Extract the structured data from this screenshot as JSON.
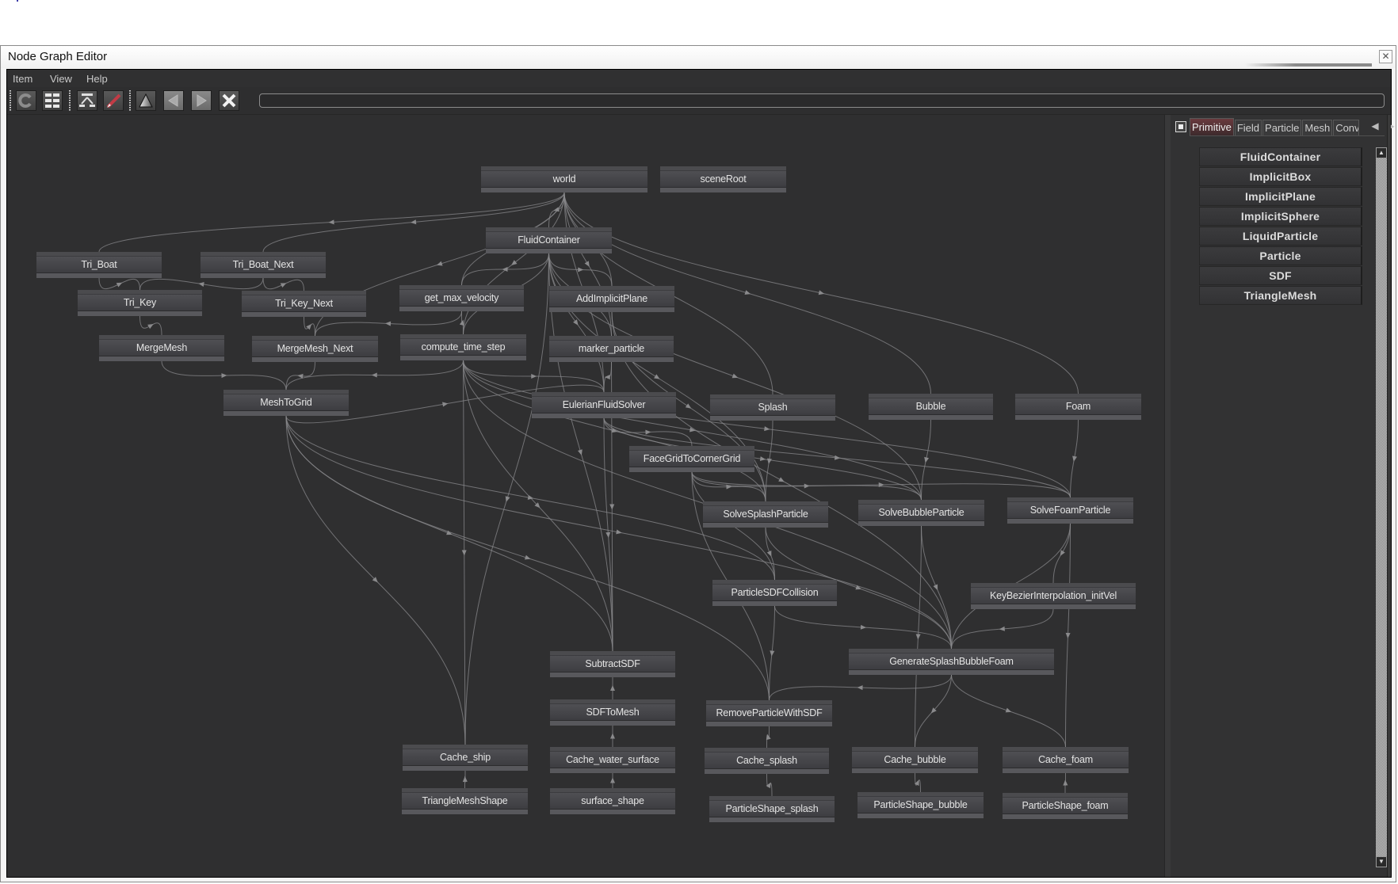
{
  "window": {
    "title": "Node Graph Editor",
    "close_icon": "close-icon"
  },
  "menu": [
    {
      "label": "Item"
    },
    {
      "label": "View"
    },
    {
      "label": "Help"
    }
  ],
  "toolbar": {
    "buttons": [
      {
        "name": "refresh",
        "icon": "refresh-icon"
      },
      {
        "name": "grid-layout",
        "icon": "grid-icon"
      },
      {
        "name": "hierarchy-layout",
        "icon": "hierarchy-icon"
      },
      {
        "name": "edit",
        "icon": "pencil-icon"
      },
      {
        "name": "up",
        "icon": "triangle-up-icon"
      },
      {
        "name": "back",
        "icon": "arrow-left-icon"
      },
      {
        "name": "forward",
        "icon": "arrow-right-icon"
      },
      {
        "name": "delete",
        "icon": "x-icon"
      }
    ],
    "search_value": ""
  },
  "graph": {
    "nodes": [
      {
        "id": "world",
        "label": "world"
      },
      {
        "id": "sceneRoot",
        "label": "sceneRoot"
      },
      {
        "id": "FluidContainer",
        "label": "FluidContainer"
      },
      {
        "id": "Tri_Boat",
        "label": "Tri_Boat"
      },
      {
        "id": "Tri_Boat_Next",
        "label": "Tri_Boat_Next"
      },
      {
        "id": "Tri_Key",
        "label": "Tri_Key"
      },
      {
        "id": "Tri_Key_Next",
        "label": "Tri_Key_Next"
      },
      {
        "id": "get_max_velocity",
        "label": "get_max_velocity"
      },
      {
        "id": "AddImplicitPlane",
        "label": "AddImplicitPlane"
      },
      {
        "id": "MergeMesh",
        "label": "MergeMesh"
      },
      {
        "id": "MergeMesh_Next",
        "label": "MergeMesh_Next"
      },
      {
        "id": "compute_time_step",
        "label": "compute_time_step"
      },
      {
        "id": "marker_particle",
        "label": "marker_particle"
      },
      {
        "id": "MeshToGrid",
        "label": "MeshToGrid"
      },
      {
        "id": "EulerianFluidSolver",
        "label": "EulerianFluidSolver"
      },
      {
        "id": "Splash",
        "label": "Splash"
      },
      {
        "id": "Bubble",
        "label": "Bubble"
      },
      {
        "id": "Foam",
        "label": "Foam"
      },
      {
        "id": "FaceGridToCornerGrid",
        "label": "FaceGridToCornerGrid"
      },
      {
        "id": "SolveSplashParticle",
        "label": "SolveSplashParticle"
      },
      {
        "id": "SolveBubbleParticle",
        "label": "SolveBubbleParticle"
      },
      {
        "id": "SolveFoamParticle",
        "label": "SolveFoamParticle"
      },
      {
        "id": "ParticleSDFCollision",
        "label": "ParticleSDFCollision"
      },
      {
        "id": "KeyBezierInterpolation_initVel",
        "label": "KeyBezierInterpolation_initVel"
      },
      {
        "id": "GenerateSplashBubbleFoam",
        "label": "GenerateSplashBubbleFoam"
      },
      {
        "id": "SubtractSDF",
        "label": "SubtractSDF"
      },
      {
        "id": "SDFToMesh",
        "label": "SDFToMesh"
      },
      {
        "id": "RemoveParticleWithSDF",
        "label": "RemoveParticleWithSDF"
      },
      {
        "id": "Cache_ship",
        "label": "Cache_ship"
      },
      {
        "id": "Cache_water_surface",
        "label": "Cache_water_surface"
      },
      {
        "id": "Cache_splash",
        "label": "Cache_splash"
      },
      {
        "id": "Cache_bubble",
        "label": "Cache_bubble"
      },
      {
        "id": "Cache_foam",
        "label": "Cache_foam"
      },
      {
        "id": "TriangleMeshShape",
        "label": "TriangleMeshShape"
      },
      {
        "id": "surface_shape",
        "label": "surface_shape"
      },
      {
        "id": "ParticleShape_splash",
        "label": "ParticleShape_splash"
      },
      {
        "id": "ParticleShape_bubble",
        "label": "ParticleShape_bubble"
      },
      {
        "id": "ParticleShape_foam",
        "label": "ParticleShape_foam"
      }
    ],
    "edges": [
      [
        "world",
        "FluidContainer"
      ],
      [
        "world",
        "Tri_Boat"
      ],
      [
        "world",
        "Tri_Boat_Next"
      ],
      [
        "world",
        "get_max_velocity"
      ],
      [
        "world",
        "AddImplicitPlane"
      ],
      [
        "world",
        "MergeMesh_Next"
      ],
      [
        "world",
        "compute_time_step"
      ],
      [
        "world",
        "marker_particle"
      ],
      [
        "world",
        "Splash"
      ],
      [
        "world",
        "Bubble"
      ],
      [
        "world",
        "Foam"
      ],
      [
        "world",
        "EulerianFluidSolver"
      ],
      [
        "FluidContainer",
        "get_max_velocity"
      ],
      [
        "FluidContainer",
        "compute_time_step"
      ],
      [
        "FluidContainer",
        "EulerianFluidSolver"
      ],
      [
        "FluidContainer",
        "AddImplicitPlane"
      ],
      [
        "FluidContainer",
        "marker_particle"
      ],
      [
        "FluidContainer",
        "SolveSplashParticle"
      ],
      [
        "FluidContainer",
        "SubtractSDF"
      ],
      [
        "FluidContainer",
        "SolveBubbleParticle"
      ],
      [
        "FluidContainer",
        "Cache_ship"
      ],
      [
        "Tri_Boat",
        "Tri_Key"
      ],
      [
        "Tri_Boat_Next",
        "Tri_Key_Next"
      ],
      [
        "Tri_Boat_Next",
        "Tri_Key"
      ],
      [
        "Tri_Key",
        "MergeMesh"
      ],
      [
        "Tri_Key_Next",
        "MergeMesh_Next"
      ],
      [
        "MergeMesh",
        "MeshToGrid"
      ],
      [
        "MergeMesh_Next",
        "MeshToGrid"
      ],
      [
        "get_max_velocity",
        "MergeMesh_Next"
      ],
      [
        "get_max_velocity",
        "compute_time_step"
      ],
      [
        "compute_time_step",
        "MeshToGrid"
      ],
      [
        "compute_time_step",
        "EulerianFluidSolver"
      ],
      [
        "compute_time_step",
        "SolveSplashParticle"
      ],
      [
        "compute_time_step",
        "SolveBubbleParticle"
      ],
      [
        "compute_time_step",
        "SolveFoamParticle"
      ],
      [
        "compute_time_step",
        "Cache_ship"
      ],
      [
        "compute_time_step",
        "GenerateSplashBubbleFoam"
      ],
      [
        "compute_time_step",
        "SubtractSDF"
      ],
      [
        "MeshToGrid",
        "EulerianFluidSolver"
      ],
      [
        "MeshToGrid",
        "Cache_ship"
      ],
      [
        "MeshToGrid",
        "SubtractSDF"
      ],
      [
        "MeshToGrid",
        "ParticleSDFCollision"
      ],
      [
        "MeshToGrid",
        "RemoveParticleWithSDF"
      ],
      [
        "MeshToGrid",
        "GenerateSplashBubbleFoam"
      ],
      [
        "AddImplicitPlane",
        "SolveSplashParticle"
      ],
      [
        "AddImplicitPlane",
        "GenerateSplashBubbleFoam"
      ],
      [
        "marker_particle",
        "EulerianFluidSolver"
      ],
      [
        "marker_particle",
        "SubtractSDF"
      ],
      [
        "EulerianFluidSolver",
        "FaceGridToCornerGrid"
      ],
      [
        "EulerianFluidSolver",
        "SubtractSDF"
      ],
      [
        "EulerianFluidSolver",
        "SolveFoamParticle"
      ],
      [
        "EulerianFluidSolver",
        "SolveBubbleParticle"
      ],
      [
        "FaceGridToCornerGrid",
        "SolveSplashParticle"
      ],
      [
        "FaceGridToCornerGrid",
        "SolveBubbleParticle"
      ],
      [
        "FaceGridToCornerGrid",
        "SolveFoamParticle"
      ],
      [
        "FaceGridToCornerGrid",
        "ParticleSDFCollision"
      ],
      [
        "FaceGridToCornerGrid",
        "RemoveParticleWithSDF"
      ],
      [
        "Splash",
        "SolveSplashParticle"
      ],
      [
        "Bubble",
        "SolveBubbleParticle"
      ],
      [
        "Foam",
        "SolveFoamParticle"
      ],
      [
        "SolveSplashParticle",
        "ParticleSDFCollision"
      ],
      [
        "SolveSplashParticle",
        "GenerateSplashBubbleFoam"
      ],
      [
        "SolveBubbleParticle",
        "GenerateSplashBubbleFoam"
      ],
      [
        "SolveFoamParticle",
        "GenerateSplashBubbleFoam"
      ],
      [
        "SolveFoamParticle",
        "KeyBezierInterpolation_initVel"
      ],
      [
        "KeyBezierInterpolation_initVel",
        "GenerateSplashBubbleFoam"
      ],
      [
        "ParticleSDFCollision",
        "GenerateSplashBubbleFoam"
      ],
      [
        "ParticleSDFCollision",
        "RemoveParticleWithSDF"
      ],
      [
        "GenerateSplashBubbleFoam",
        "RemoveParticleWithSDF"
      ],
      [
        "GenerateSplashBubbleFoam",
        "Cache_bubble"
      ],
      [
        "GenerateSplashBubbleFoam",
        "Cache_foam"
      ],
      [
        "SubtractSDF",
        "SDFToMesh"
      ],
      [
        "SDFToMesh",
        "Cache_water_surface"
      ],
      [
        "RemoveParticleWithSDF",
        "Cache_splash"
      ],
      [
        "Cache_ship",
        "TriangleMeshShape"
      ],
      [
        "Cache_water_surface",
        "surface_shape"
      ],
      [
        "Cache_splash",
        "ParticleShape_splash"
      ],
      [
        "Cache_bubble",
        "ParticleShape_bubble"
      ],
      [
        "Cache_foam",
        "ParticleShape_foam"
      ],
      [
        "SolveBubbleParticle",
        "Cache_bubble"
      ],
      [
        "SolveFoamParticle",
        "Cache_foam"
      ]
    ]
  },
  "library_panel": {
    "fit_icon": "fit-view-icon",
    "tabs": [
      {
        "label": "Primitive",
        "active": true
      },
      {
        "label": "Field",
        "active": false
      },
      {
        "label": "Particle",
        "active": false
      },
      {
        "label": "Mesh",
        "active": false
      },
      {
        "label": "Conv",
        "active": false
      }
    ],
    "items": [
      {
        "label": "FluidContainer"
      },
      {
        "label": "ImplicitBox"
      },
      {
        "label": "ImplicitPlane"
      },
      {
        "label": "ImplicitSphere"
      },
      {
        "label": "LiquidParticle"
      },
      {
        "label": "Particle"
      },
      {
        "label": "SDF"
      },
      {
        "label": "TriangleMesh"
      }
    ]
  },
  "colors": {
    "canvas_bg": "#2f2f30",
    "edge": "#8a8a8c",
    "node_text": "#e4e4e4",
    "active_tab": "#6a3a3e"
  }
}
